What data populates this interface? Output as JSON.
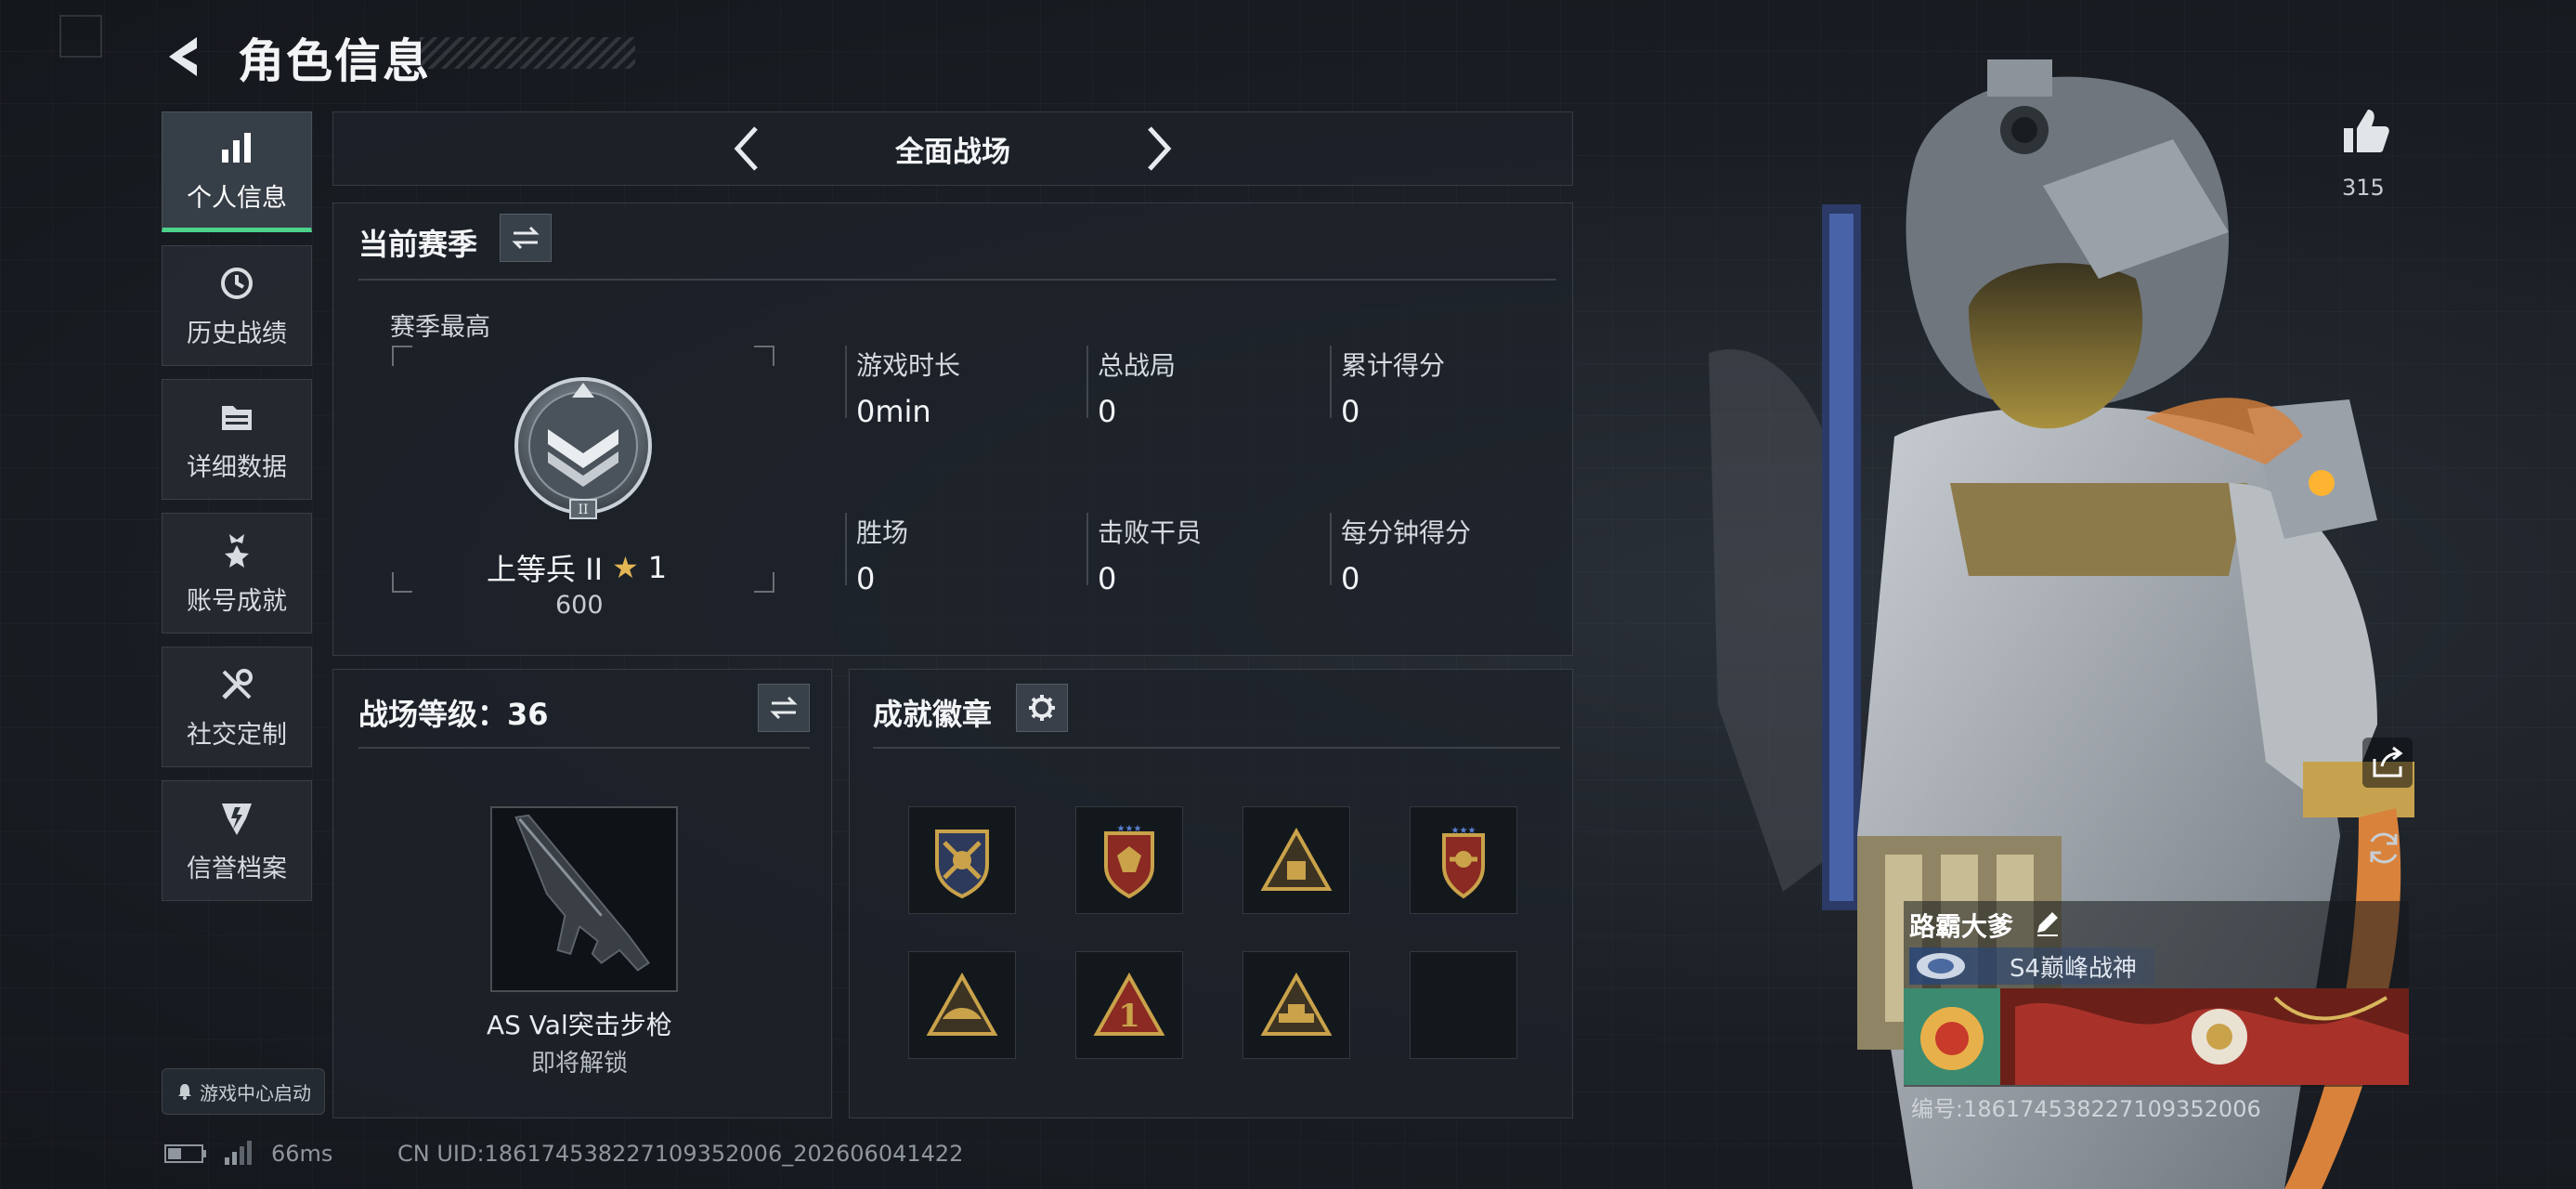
{
  "header": {
    "title": "角色信息"
  },
  "sidebar": {
    "items": [
      {
        "label": "个人信息",
        "icon": "bar-chart-icon",
        "active": true
      },
      {
        "label": "历史战绩",
        "icon": "history-icon"
      },
      {
        "label": "详细数据",
        "icon": "folder-icon"
      },
      {
        "label": "账号成就",
        "icon": "achievement-icon"
      },
      {
        "label": "社交定制",
        "icon": "tools-icon"
      },
      {
        "label": "信誉档案",
        "icon": "reputation-icon"
      }
    ],
    "game_center": "游戏中心启动"
  },
  "mode": {
    "title": "全面战场"
  },
  "season": {
    "title": "当前赛季",
    "best_label": "赛季最高",
    "rank_name": "上等兵 II",
    "rank_stars": "1",
    "rank_points": "600",
    "rank_roman": "II",
    "stats": [
      {
        "label": "游戏时长",
        "value": "0min"
      },
      {
        "label": "总战局",
        "value": "0"
      },
      {
        "label": "累计得分",
        "value": "0"
      },
      {
        "label": "胜场",
        "value": "0"
      },
      {
        "label": "击败干员",
        "value": "0"
      },
      {
        "label": "每分钟得分",
        "value": "0"
      }
    ]
  },
  "level": {
    "title": "战场等级：36",
    "weapon_name": "AS Val突击步枪",
    "weapon_status": "即将解锁"
  },
  "badges": {
    "title": "成就徽章",
    "items": [
      "shield-crossed-badge",
      "star-shield-badge",
      "pyramid-badge",
      "winged-shield-badge",
      "tent-badge",
      "number-one-badge",
      "tank-badge",
      "empty-slot"
    ],
    "numeral": "1"
  },
  "footer": {
    "ping": "66ms",
    "uid": "CN UID:18617453822710935200​6_202606041422"
  },
  "likes": {
    "count": "315"
  },
  "player_card": {
    "name": "路霸大爹",
    "title": "S4巅峰战神",
    "id_text": "编号:18617453822710935200​6"
  },
  "colors": {
    "accent": "#4cd28a",
    "badge_gold": "#c9a24a",
    "badge_red": "#8a2a22"
  }
}
